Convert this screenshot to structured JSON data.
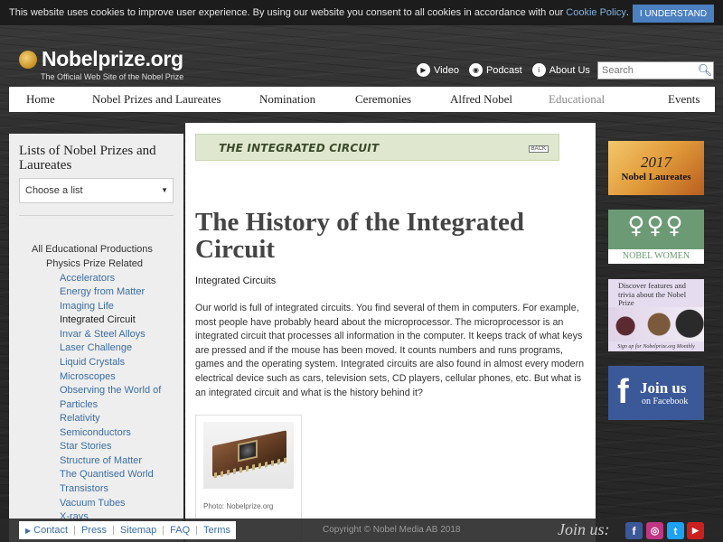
{
  "cookie": {
    "message": "This website uses cookies to improve user experience. By using our website you consent to all cookies in accordance with our",
    "policy_link": "Cookie Policy",
    "period": ".",
    "button": "I UNDERSTAND"
  },
  "header": {
    "logo": "Nobelprize.org",
    "tagline": "The Official Web Site of the Nobel Prize",
    "media_links": [
      {
        "label": "Video",
        "icon": "play-icon"
      },
      {
        "label": "Podcast",
        "icon": "podcast-icon"
      },
      {
        "label": "About Us",
        "icon": "info-icon"
      }
    ],
    "search_placeholder": "Search"
  },
  "nav": {
    "items": [
      "Home",
      "Nobel Prizes and Laureates",
      "Nomination",
      "Ceremonies",
      "Alfred Nobel",
      "Educational",
      "Events"
    ],
    "active": "Educational"
  },
  "sidebar": {
    "title": "Lists of Nobel Prizes and Laureates",
    "select_value": "Choose a list",
    "level1": "All Educational Productions",
    "level2": "Physics Prize Related",
    "items": [
      "Accelerators",
      "Energy from Matter",
      "Imaging Life",
      "Integrated Circuit",
      "Invar & Steel Alloys",
      "Laser Challenge",
      "Liquid Crystals",
      "Microscopes",
      "Observing the World of",
      "Particles",
      "Relativity",
      "Semiconductors",
      "Star Stories",
      "Structure of Matter",
      "The Quantised World",
      "Transistors",
      "Vacuum Tubes",
      "X-rays"
    ],
    "current": "Integrated Circuit"
  },
  "content": {
    "banner_title": "THE INTEGRATED CIRCUIT",
    "back_label": "BACK",
    "title": "The History of the Integrated Circuit",
    "subhead": "Integrated Circuits",
    "body": "Our world is full of integrated circuits. You find several of them in computers. For example, most people have probably heard about the microprocessor. The microprocessor is an integrated circuit that processes all information in the computer. It keeps track of what keys are pressed and if the mouse has been moved. It counts numbers and runs programs, games and the operating system. Integrated circuits are also found in almost every modern electrical device such as cars, television sets, CD players, cellular phones, etc. But what is an integrated circuit and what is the history behind it?",
    "photo_caption": "Photo: Nobelprize.org"
  },
  "promos": {
    "laureates_year": "2017",
    "laureates_label": "Nobel Laureates",
    "women_symbols": "♀♀♀",
    "women_label": "NOBEL WOMEN",
    "discover_text": "Discover features and trivia about the Nobel Prize",
    "discover_signup": "Sign up for Nobelprize.org Monthly",
    "fb_letter": "f",
    "fb_join": "Join us",
    "fb_on": "on Facebook"
  },
  "footer": {
    "links": [
      "Contact",
      "Press",
      "Sitemap",
      "FAQ",
      "Terms"
    ],
    "copyright": "Copyright © Nobel Media AB 2018",
    "join_us": "Join us:",
    "social": [
      {
        "name": "facebook-icon",
        "glyph": "f",
        "color": "#3b5998"
      },
      {
        "name": "instagram-icon",
        "glyph": "◎",
        "color": "#c13584"
      },
      {
        "name": "twitter-icon",
        "glyph": "t",
        "color": "#1da1f2"
      },
      {
        "name": "youtube-icon",
        "glyph": "▶",
        "color": "#cc2020"
      }
    ]
  }
}
